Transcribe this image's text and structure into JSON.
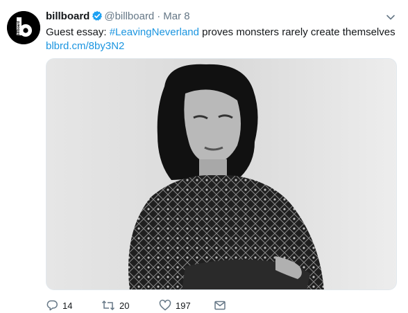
{
  "tweet": {
    "display_name": "billboard",
    "handle": "@billboard",
    "separator": "·",
    "timestamp": "Mar 8",
    "text_before": "Guest essay: ",
    "hashtag": "#LeavingNeverland",
    "text_after": " proves monsters rarely create themselves",
    "link": "blbrd.cm/8by3N2",
    "avatar_logo_text": "billboard"
  },
  "actions": {
    "replies": "14",
    "retweets": "20",
    "likes": "197"
  },
  "colors": {
    "link": "#1b95e0",
    "secondary_text": "#657786",
    "verified_badge": "#1da1f2"
  },
  "icons": {
    "avatar": "billboard-b-logo",
    "verified": "verified-badge-icon",
    "caret": "chevron-down-icon",
    "reply": "reply-icon",
    "retweet": "retweet-icon",
    "like": "heart-icon",
    "dm": "envelope-icon"
  }
}
